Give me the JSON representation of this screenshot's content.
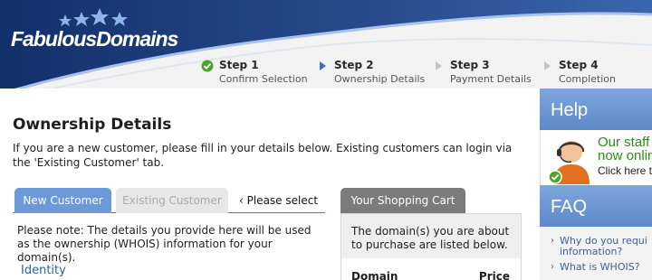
{
  "brand": {
    "name": "FabulousDomains"
  },
  "steps": [
    {
      "number": "Step 1",
      "label": "Confirm Selection",
      "state": "done"
    },
    {
      "number": "Step 2",
      "label": "Ownership Details",
      "state": "current"
    },
    {
      "number": "Step 3",
      "label": "Payment Details",
      "state": "pending"
    },
    {
      "number": "Step 4",
      "label": "Completion",
      "state": "pending"
    }
  ],
  "main": {
    "title": "Ownership Details",
    "intro": "If you are a new customer, please fill in your details below. Existing customers can login via the 'Existing Customer' tab.",
    "tabs": [
      {
        "label": "New Customer",
        "active": true
      },
      {
        "label": "Existing Customer",
        "active": false
      }
    ],
    "tab_hint": "‹ Please select",
    "note": "Please note: The details you provide here will be used as the ownership (WHOIS) information for your domain(s).",
    "section_heading": "Identity"
  },
  "cart": {
    "tab_label": "Your Shopping Cart",
    "message": "The domain(s) you are about to purchase are listed below.",
    "columns": [
      "Domain",
      "Price"
    ]
  },
  "sidebar": {
    "help_title": "Help",
    "help_lines": [
      "Our staff a",
      "now onlin",
      "Click here to"
    ],
    "faq_title": "FAQ",
    "faq_items": [
      "Why do you requi",
      "information?",
      "What is WHOIS?"
    ]
  },
  "colors": {
    "header_navy": "#1f3d7a",
    "accent_blue": "#6c9ad9",
    "help_green": "#2f8a1c",
    "step_done_green": "#4aa52e"
  }
}
